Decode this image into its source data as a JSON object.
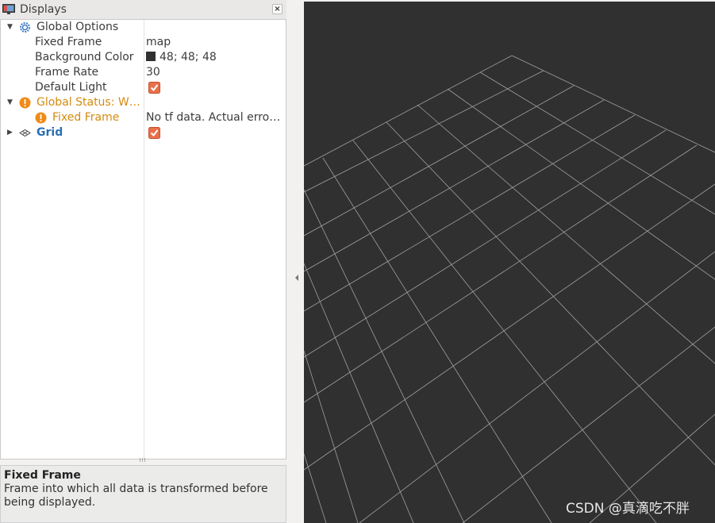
{
  "panel": {
    "title": "Displays",
    "close_glyph": "×"
  },
  "tree": {
    "global_options": {
      "label": "Global Options",
      "icon": "gear-icon"
    },
    "fixed_frame": {
      "label": "Fixed Frame",
      "value": "map"
    },
    "background_color": {
      "label": "Background Color",
      "value": "48; 48; 48",
      "swatch_color": "#303030"
    },
    "frame_rate": {
      "label": "Frame Rate",
      "value": "30"
    },
    "default_light": {
      "label": "Default Light",
      "checked": true
    },
    "global_status": {
      "label": "Global Status: W…",
      "icon": "warning-icon"
    },
    "status_fixed_frame": {
      "label": "Fixed Frame",
      "value": "No tf data.  Actual erro…",
      "icon": "warning-icon"
    },
    "grid": {
      "label": "Grid",
      "checked": true,
      "icon": "grid-icon"
    }
  },
  "help": {
    "title": "Fixed Frame",
    "text": "Frame into which all data is transformed before being displayed."
  },
  "viewport": {
    "background": "#303030",
    "grid_color": "#a0a0a0"
  },
  "watermark": "CSDN @真滴吃不胖",
  "colors": {
    "warning": "#d58a0e",
    "link_blue": "#2a6fb3",
    "checkbox": "#e8704a"
  }
}
